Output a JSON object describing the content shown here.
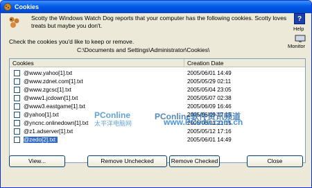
{
  "window": {
    "title": "Cookies"
  },
  "intro": "Scotty the Windows Watch Dog reports that your computer has the following cookies. Scotty loves treats but maybe you don't.",
  "help_label": "Help",
  "monitor_label": "Monitor",
  "check_label": "Check the cookies you'd like to keep or remove.",
  "path": "C:\\Documents and Settings\\Administrator\\Cookies\\",
  "list": {
    "headers": {
      "cookies": "Cookies",
      "date": "Creation Date"
    },
    "rows": [
      {
        "name": "@www.yahoo[1].txt",
        "date": "2005/06/01 14:49",
        "selected": false
      },
      {
        "name": "@www.zdnet.com[1].txt",
        "date": "2005/05/29 02:11",
        "selected": false
      },
      {
        "name": "@www.zgcsc[1].txt",
        "date": "2005/05/04 23:05",
        "selected": false
      },
      {
        "name": "@www1.jcdown[1].txt",
        "date": "2005/05/07 02:38",
        "selected": false
      },
      {
        "name": "@www3.eastgame[1].txt",
        "date": "2005/06/09 16:46",
        "selected": false
      },
      {
        "name": "@yahoo[1].txt",
        "date": "2005/06/09 17:15",
        "selected": false
      },
      {
        "name": "@yncnc.onlinedown[1].txt",
        "date": "2005/06/01 21:15",
        "selected": false
      },
      {
        "name": "@z1.adserver[1].txt",
        "date": "2005/05/12 17:16",
        "selected": false
      },
      {
        "name": "@zedo[2].txt",
        "date": "2005/06/01 14:49",
        "selected": true
      }
    ]
  },
  "watermark": {
    "brand": "PConline",
    "brand_cn": "太平洋电脑网",
    "brand2": "PConline软件资讯频道",
    "site": "www.PCedu.com.cn"
  },
  "buttons": {
    "view": "View...",
    "remove_unchecked": "Remove Unchecked",
    "remove_checked": "Remove Checked",
    "close": "Close"
  },
  "colors": {
    "titlebar": "#0054e3",
    "selection": "#316ac5",
    "face": "#ece9d8"
  }
}
